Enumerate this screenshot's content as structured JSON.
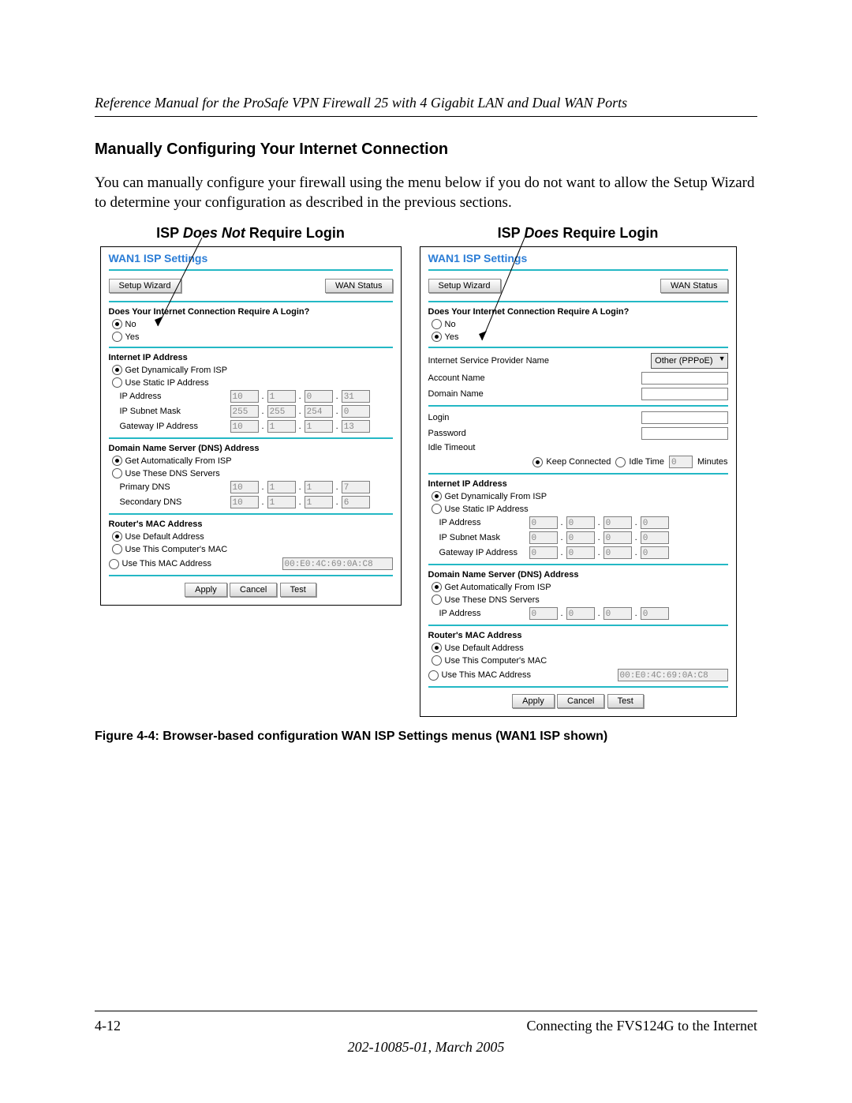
{
  "header": "Reference Manual for the ProSafe VPN Firewall 25 with 4 Gigabit LAN and Dual WAN Ports",
  "section_heading": "Manually Configuring Your Internet Connection",
  "paragraph": "You can manually configure your firewall using the menu below if you do not want to allow the Setup Wizard to determine your configuration as described in the previous sections.",
  "col_left_title_a": "ISP ",
  "col_left_title_em": "Does Not",
  "col_left_title_b": " Require Login",
  "col_right_title_a": "ISP ",
  "col_right_title_em": "Does",
  "col_right_title_b": " Require Login",
  "common": {
    "panel_title": "WAN1 ISP Settings",
    "setup_wizard": "Setup Wizard",
    "wan_status": "WAN Status",
    "login_q": "Does Your Internet Connection Require A Login?",
    "no": "No",
    "yes": "Yes",
    "internet_ip": "Internet IP Address",
    "get_dyn": "Get Dynamically From ISP",
    "use_static": "Use Static IP Address",
    "ip_address": "IP Address",
    "ip_subnet": "IP Subnet Mask",
    "gateway_ip": "Gateway IP Address",
    "dns_header": "Domain Name Server (DNS) Address",
    "get_auto": "Get Automatically From ISP",
    "use_dns": "Use These DNS Servers",
    "primary_dns": "Primary DNS",
    "secondary_dns": "Secondary DNS",
    "mac_header": "Router's MAC Address",
    "use_default": "Use Default Address",
    "use_comp_mac": "Use This Computer's MAC",
    "use_mac_addr": "Use This MAC Address",
    "mac_value": "00:E0:4C:69:0A:C8",
    "apply": "Apply",
    "cancel": "Cancel",
    "test": "Test"
  },
  "left": {
    "ip": [
      "10",
      "1",
      "0",
      "31"
    ],
    "mask": [
      "255",
      "255",
      "254",
      "0"
    ],
    "gw": [
      "10",
      "1",
      "1",
      "13"
    ],
    "pdns": [
      "10",
      "1",
      "1",
      "7"
    ],
    "sdns": [
      "10",
      "1",
      "1",
      "6"
    ]
  },
  "right": {
    "isp_name": "Internet Service Provider Name",
    "isp_select": "Other (PPPoE)",
    "acct": "Account Name",
    "domain": "Domain Name",
    "login": "Login",
    "password": "Password",
    "idle_timeout": "Idle Timeout",
    "keep": "Keep Connected",
    "idle_time": "Idle Time",
    "idle_val": "0",
    "minutes": "Minutes",
    "ip_label": "IP Address",
    "zeros": [
      "0",
      "0",
      "0",
      "0"
    ]
  },
  "figcaption": "Figure 4-4:  Browser-based configuration WAN ISP Settings menus (WAN1 ISP shown)",
  "footer": {
    "page": "4-12",
    "chapter": "Connecting the FVS124G to the Internet",
    "date": "202-10085-01, March 2005"
  }
}
